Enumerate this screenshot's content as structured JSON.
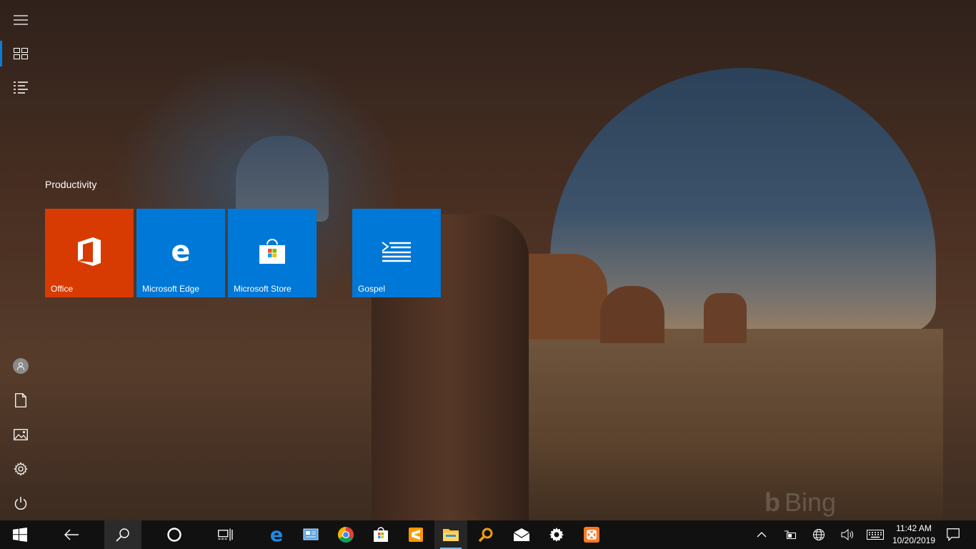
{
  "wallpaper": {
    "watermark": "Bing"
  },
  "rail": {
    "items": [
      {
        "name": "hamburger-menu",
        "icon": "hamburger-icon"
      },
      {
        "name": "pinned-tiles",
        "icon": "tiles-icon",
        "active": true
      },
      {
        "name": "all-apps",
        "icon": "list-icon"
      },
      {
        "name": "user-account",
        "icon": "user-icon"
      },
      {
        "name": "documents",
        "icon": "document-icon"
      },
      {
        "name": "pictures",
        "icon": "picture-icon"
      },
      {
        "name": "settings",
        "icon": "gear-icon"
      },
      {
        "name": "power",
        "icon": "power-icon"
      }
    ]
  },
  "tiles": {
    "group_title": "Productivity",
    "items": [
      {
        "label": "Office",
        "color": "#d83b01",
        "icon": "office-icon"
      },
      {
        "label": "Microsoft Edge",
        "color": "#0078d7",
        "icon": "edge-icon"
      },
      {
        "label": "Microsoft Store",
        "color": "#0078d7",
        "icon": "store-icon"
      },
      {
        "label": "Gospel",
        "color": "#0078d7",
        "icon": "gospel-icon"
      }
    ]
  },
  "taskbar": {
    "pinned": [
      "windows-start-icon",
      "back-arrow-icon",
      "search-icon",
      "cortana-icon",
      "task-view-icon",
      "edge-icon",
      "control-panel-icon",
      "chrome-icon",
      "store-icon",
      "sublime-icon",
      "file-explorer-icon",
      "search-app-icon",
      "mail-icon",
      "gear-icon",
      "xampp-icon"
    ],
    "tray": [
      "chevron-up-icon",
      "battery-icon",
      "network-icon",
      "volume-icon",
      "keyboard-icon",
      "notification-icon"
    ],
    "time": "11:42 AM",
    "date": "10/20/2019"
  }
}
